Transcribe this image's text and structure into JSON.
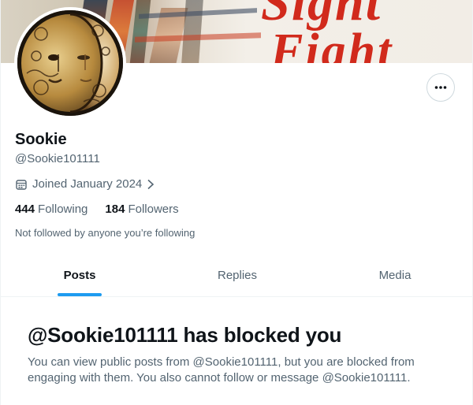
{
  "banner": {
    "text_top": "Sight",
    "text_main": "Fight"
  },
  "profile": {
    "display_name": "Sookie",
    "handle": "@Sookie101111",
    "joined": "Joined January 2024",
    "following_count": "444",
    "following_label": "Following",
    "followers_count": "184",
    "followers_label": "Followers",
    "not_followed_text": "Not followed by anyone you’re following"
  },
  "tabs": [
    {
      "label": "Posts",
      "active": true
    },
    {
      "label": "Replies",
      "active": false
    },
    {
      "label": "Media",
      "active": false
    }
  ],
  "blocked": {
    "title": "@Sookie101111 has blocked you",
    "body": "You can view public posts from @Sookie101111, but you are blocked from engaging with them. You also cannot follow or message @Sookie101111."
  },
  "icons": {
    "more": "more-horizontal-icon",
    "calendar": "calendar-icon",
    "chevron": "chevron-right-icon"
  },
  "colors": {
    "accent": "#1d9bf0",
    "text_primary": "#0f1419",
    "text_secondary": "#536471",
    "banner_red": "#d12a1c"
  }
}
